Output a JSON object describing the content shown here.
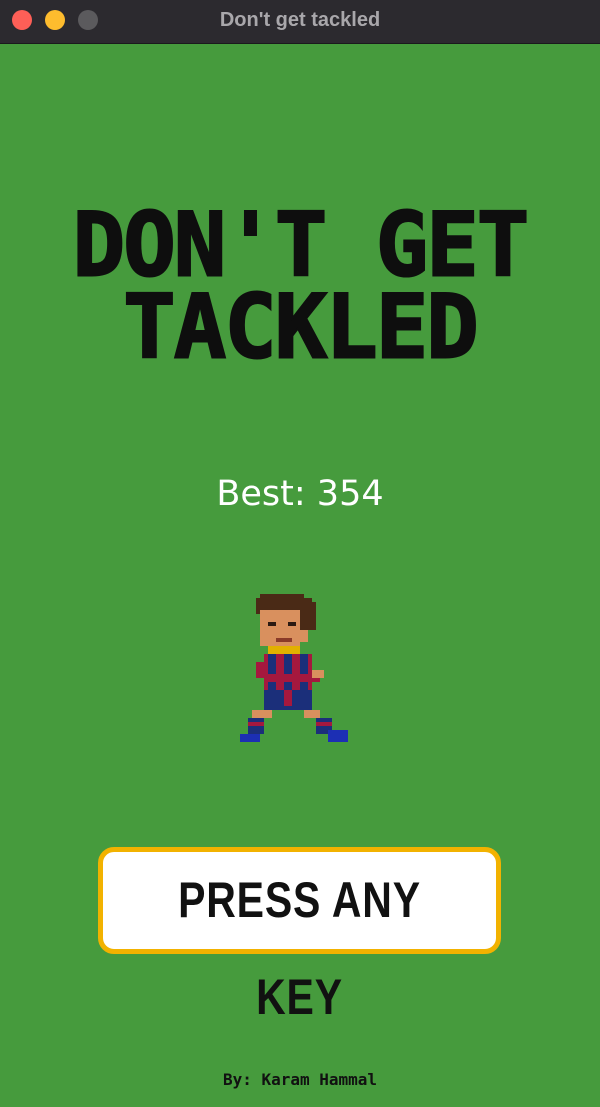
{
  "window": {
    "title": "Don't get tackled"
  },
  "game": {
    "title_line1": "DON'T GET",
    "title_line2": "TACKLED",
    "best_label": "Best: 354",
    "start_prompt": "PRESS ANY KEY",
    "credit": "By: Karam Hammal",
    "player_sprite": "pixel-art-footballer"
  },
  "colors": {
    "field": "#469b3d",
    "title_text": "#0e0e0e",
    "best_text": "#ffffff",
    "button_bg": "#ffffff",
    "button_border": "#f2b200"
  }
}
